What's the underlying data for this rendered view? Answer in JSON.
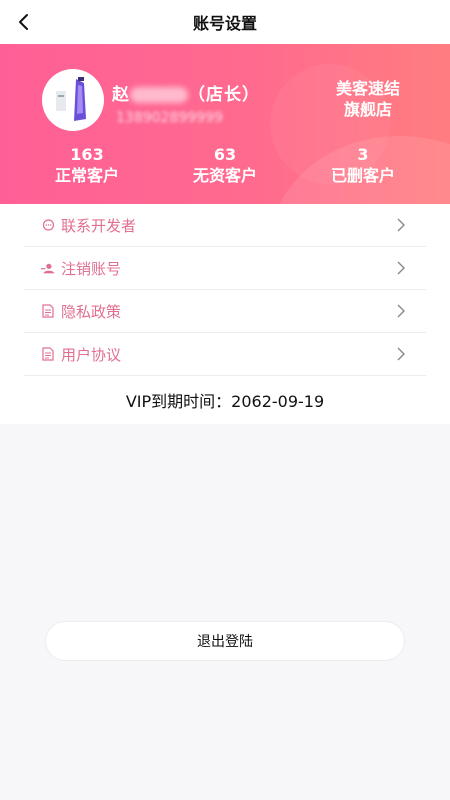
{
  "nav": {
    "title": "账号设置"
  },
  "profile": {
    "name": "赵",
    "name_suffix": "（店长）",
    "phone": "138902899999",
    "shop_line1": "美客速结",
    "shop_line2": "旗舰店"
  },
  "stats": [
    {
      "value": "163",
      "label": "正常客户"
    },
    {
      "value": "63",
      "label": "无资客户"
    },
    {
      "value": "3",
      "label": "已删客户"
    }
  ],
  "menu": [
    {
      "label": "联系开发者",
      "icon": "chat-icon"
    },
    {
      "label": "注销账号",
      "icon": "user-remove-icon"
    },
    {
      "label": "隐私政策",
      "icon": "document-icon"
    },
    {
      "label": "用户协议",
      "icon": "document-icon"
    }
  ],
  "vip": {
    "text": "VIP到期时间：2062-09-19"
  },
  "logout": {
    "label": "退出登陆"
  },
  "colors": {
    "accent": "#ff5f96",
    "menu_text": "#e07090"
  }
}
